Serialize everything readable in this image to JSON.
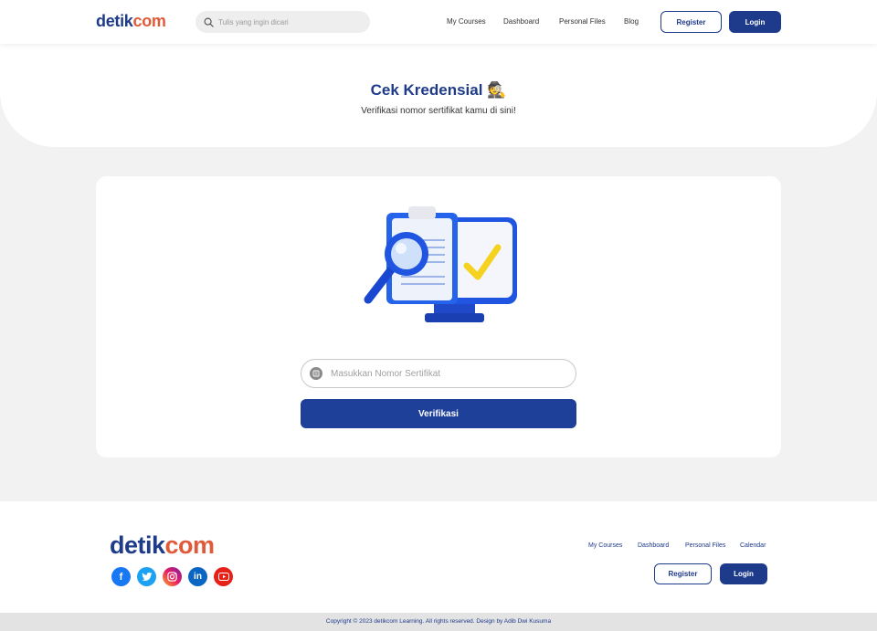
{
  "header": {
    "logo_part1": "detik",
    "logo_part2": "com",
    "search_placeholder": "Tulis yang ingin dicari",
    "nav": [
      "My Courses",
      "Dashboard",
      "Personal Files",
      "Blog"
    ],
    "register_label": "Register",
    "login_label": "Login"
  },
  "hero": {
    "title": "Cek Kredensial 🕵️",
    "subtitle": "Verifikasi nomor sertifikat kamu di sini!"
  },
  "form": {
    "illustration": "verification-illustration",
    "cert_placeholder": "Masukkan Nomor Sertifikat",
    "cert_value": "",
    "verify_label": "Verifikasi"
  },
  "footer": {
    "logo_part1": "detik",
    "logo_part2": "com",
    "socials": [
      "facebook-icon",
      "twitter-icon",
      "instagram-icon",
      "linkedin-icon",
      "youtube-icon"
    ],
    "nav": [
      "My Courses",
      "Dashboard",
      "Personal Files",
      "Calendar"
    ],
    "register_label": "Register",
    "login_label": "Login",
    "copyright": "Copyright © 2023 detikcom Learning. All rights reserved. Design by Adib Dwi Kusuma"
  },
  "colors": {
    "brand_primary": "#1e3a8a",
    "brand_accent": "#e05a3a",
    "button_primary": "#1e4099"
  }
}
